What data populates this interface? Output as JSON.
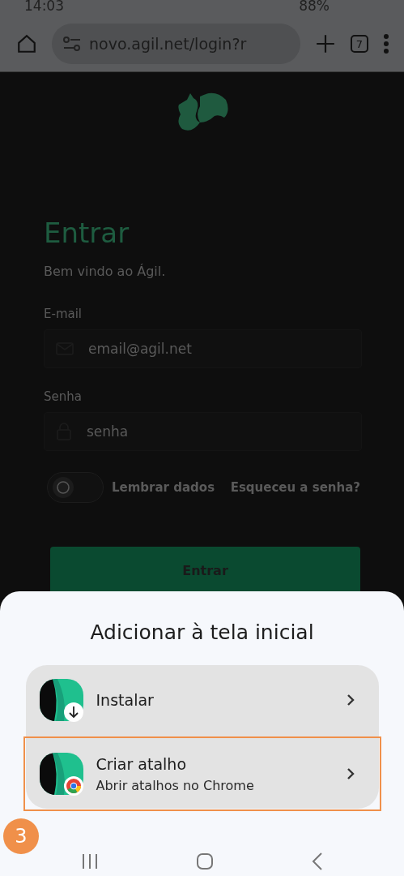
{
  "status_bar": {
    "time": "14:03",
    "battery": "88%"
  },
  "browser": {
    "url": "novo.agil.net/login?r",
    "tab_count": "7"
  },
  "login": {
    "title": "Entrar",
    "subtitle": "Bem vindo ao Ágil.",
    "fields": [
      {
        "label": "E-mail",
        "placeholder": "email@agil.net",
        "kind": "email"
      },
      {
        "label": "Senha",
        "placeholder": "senha",
        "kind": "password"
      }
    ],
    "remember": {
      "label": "Lembrar dados",
      "on": false
    },
    "forgot": "Esqueceu a senha?",
    "submit": "Entrar"
  },
  "sheet": {
    "title": "Adicionar à tela inicial",
    "items": [
      {
        "title": "Instalar",
        "kind": "install",
        "highlighted": false
      },
      {
        "title": "Criar atalho",
        "subtitle": "Abrir atalhos no Chrome",
        "kind": "shortcut",
        "highlighted": true
      }
    ]
  },
  "step_badge": "3"
}
